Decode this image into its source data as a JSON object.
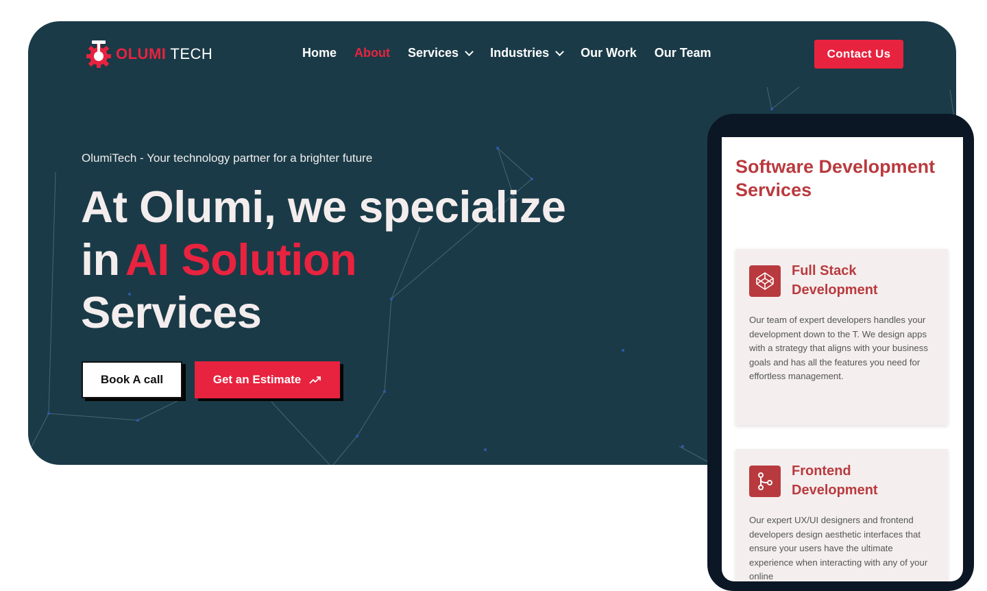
{
  "brand": {
    "name_part1": "OLUMI",
    "name_part2": "TECH"
  },
  "nav": {
    "items": [
      {
        "label": "Home"
      },
      {
        "label": "About"
      },
      {
        "label": "Services"
      },
      {
        "label": "Industries"
      },
      {
        "label": "Our Work"
      },
      {
        "label": "Our Team"
      }
    ],
    "active": "About",
    "contact_label": "Contact Us"
  },
  "hero": {
    "tagline": "OlumiTech - Your technology partner for a brighter future",
    "headline_line1": "At Olumi, we specialize",
    "headline_in": "in",
    "headline_accent": "AI Solution",
    "headline_line3": "Services",
    "book_label": "Book A call",
    "estimate_label": "Get an Estimate"
  },
  "mobile": {
    "title": "Software Development Services",
    "cards": [
      {
        "title": "Full Stack Development",
        "text": "Our team of expert developers handles your development down to the T. We design apps with a strategy that aligns with your business goals and has all the features you need for effortless management."
      },
      {
        "title": "Frontend Development",
        "text": "Our expert UX/UI designers and frontend developers design aesthetic interfaces that ensure your users have the ultimate experience when interacting with any of your online"
      }
    ]
  },
  "colors": {
    "hero_bg": "#1a3a47",
    "accent_red": "#e8233f",
    "card_red": "#b93a3e",
    "phone_frame": "#0b1725",
    "card_bg": "#f4eeee"
  },
  "icons": [
    "logo-gear-icon",
    "chevron-down-icon",
    "trend-up-arrow-icon",
    "codepen-cube-icon",
    "git-branch-icon"
  ]
}
